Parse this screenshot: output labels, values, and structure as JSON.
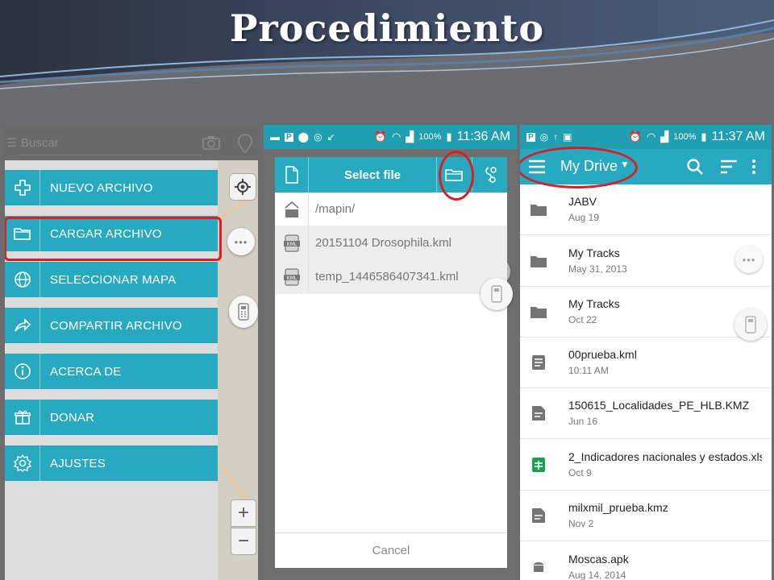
{
  "slide": {
    "title": "Procedimiento"
  },
  "colors": {
    "accent": "#27a9bf",
    "statusbar": "#1f9fb1",
    "highlight": "#d81f26"
  },
  "panel1": {
    "search_placeholder": "Buscar",
    "menu": [
      {
        "label": "NUEVO ARCHIVO",
        "icon": "plus-icon"
      },
      {
        "label": "CARGAR ARCHIVO",
        "icon": "folder-icon",
        "highlighted": true
      },
      {
        "label": "SELECCIONAR MAPA",
        "icon": "globe-icon"
      },
      {
        "label": "COMPARTIR ARCHIVO",
        "icon": "share-icon"
      },
      {
        "label": "ACERCA DE",
        "icon": "info-icon"
      },
      {
        "label": "DONAR",
        "icon": "gift-icon"
      },
      {
        "label": "AJUSTES",
        "icon": "gear-icon"
      }
    ],
    "zoom_in": "+",
    "zoom_out": "−",
    "more": "•••"
  },
  "panel2": {
    "status": {
      "battery": "100%",
      "time": "11:36 AM"
    },
    "dialog_title": "Select file",
    "files": [
      {
        "name": "/mapin/",
        "icon": "folder-up-icon"
      },
      {
        "name": "20151104 Drosophila.kml",
        "icon": "kml-file-icon"
      },
      {
        "name": "temp_1446586407341.kml",
        "icon": "kml-file-icon"
      }
    ],
    "cancel": "Cancel",
    "more": "•••"
  },
  "panel3": {
    "status": {
      "battery": "100%",
      "time": "11:37 AM"
    },
    "title": "My Drive",
    "items": [
      {
        "name": "JABV",
        "date": "Aug 19",
        "icon": "folder-icon"
      },
      {
        "name": "My Tracks",
        "date": "May 31, 2013",
        "icon": "folder-icon"
      },
      {
        "name": "My Tracks",
        "date": "Oct 22",
        "icon": "folder-icon"
      },
      {
        "name": "00prueba.kml",
        "date": "10:11 AM",
        "icon": "document-icon"
      },
      {
        "name": "150615_Localidades_PE_HLB.KMZ",
        "date": "Jun 16",
        "icon": "document-icon"
      },
      {
        "name": "2_Indicadores nacionales y estados.xls",
        "date": "Oct 9",
        "icon": "sheets-icon"
      },
      {
        "name": "milxmil_prueba.kmz",
        "date": "Nov 2",
        "icon": "document-icon"
      },
      {
        "name": "Moscas.apk",
        "date": "Aug 14, 2014",
        "icon": "android-icon"
      }
    ],
    "more": "•••"
  }
}
